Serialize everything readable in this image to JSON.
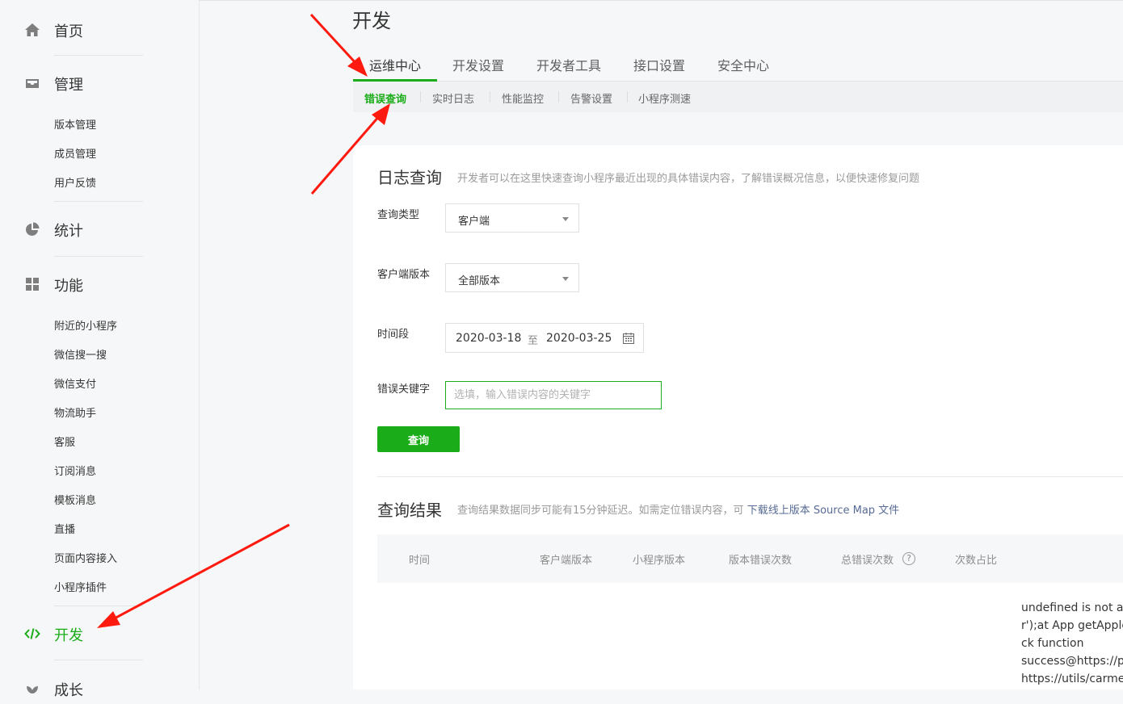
{
  "sidebar": {
    "home": "首页",
    "manage": {
      "label": "管理",
      "items": [
        "版本管理",
        "成员管理",
        "用户反馈"
      ]
    },
    "stats": "统计",
    "features": {
      "label": "功能",
      "items": [
        "附近的小程序",
        "微信搜一搜",
        "微信支付",
        "物流助手",
        "客服",
        "订阅消息",
        "模板消息",
        "直播",
        "页面内容接入",
        "小程序插件"
      ]
    },
    "develop": "开发",
    "growth": "成长"
  },
  "page": {
    "title": "开发",
    "tabs": [
      "运维中心",
      "开发设置",
      "开发者工具",
      "接口设置",
      "安全中心"
    ],
    "subtabs": [
      "错误查询",
      "实时日志",
      "性能监控",
      "告警设置",
      "小程序测速"
    ]
  },
  "log_query": {
    "title": "日志查询",
    "desc": "开发者可以在这里快速查询小程序最近出现的具体错误内容，了解错误概况信息，以便快速修复问题",
    "query_type_label": "查询类型",
    "query_type_value": "客户端",
    "client_version_label": "客户端版本",
    "client_version_value": "全部版本",
    "time_label": "时间段",
    "date_start": "2020-03-18",
    "date_sep": "至",
    "date_end": "2020-03-25",
    "keyword_label": "错误关键字",
    "keyword_placeholder": "选填，输入错误内容的关键字",
    "query_button": "查询"
  },
  "results": {
    "title": "查询结果",
    "desc": "查询结果数据同步可能有15分钟延迟。如需定位错误内容，可",
    "link": "下载线上版本 Source Map 文件",
    "columns": [
      "时间",
      "客户端版本",
      "小程序版本",
      "版本错误次数",
      "总错误次数",
      "次数占比"
    ],
    "help_glyph": "?",
    "error_lines": [
      "undefined is not ar",
      "r');at App getApplc",
      "ck function",
      "success@https://pa",
      "https://utils/carme"
    ]
  },
  "colors": {
    "accent": "#1aad19",
    "link": "#576b95",
    "arrow": "#ff1a0f"
  }
}
